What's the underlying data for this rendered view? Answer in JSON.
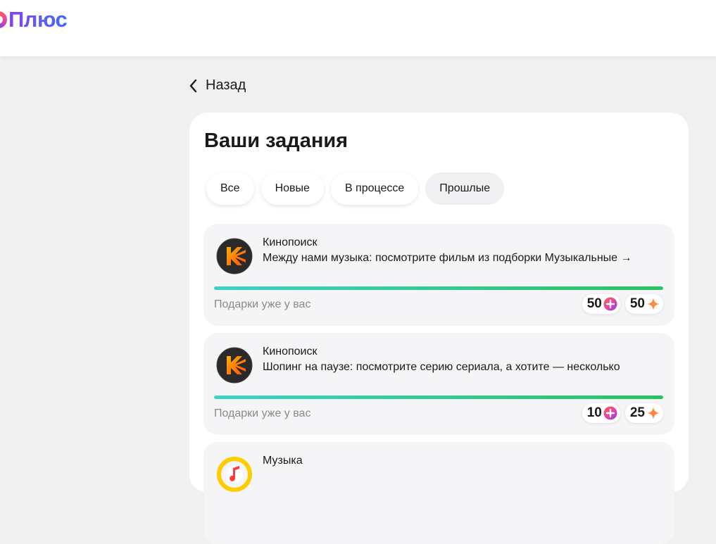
{
  "header": {
    "logo_text": "Плюс"
  },
  "back": {
    "label": "Назад"
  },
  "panel": {
    "title": "Ваши задания",
    "tabs": [
      {
        "label": "Все",
        "active": false
      },
      {
        "label": "Новые",
        "active": false
      },
      {
        "label": "В процессе",
        "active": false
      },
      {
        "label": "Прошлые",
        "active": true
      }
    ]
  },
  "tasks": [
    {
      "service": "Кинопоиск",
      "icon": "kinopoisk-logo-icon",
      "title": "Между нами музыка: посмотрите фильм из подборки Музыкальные →",
      "progress": 1.0,
      "status": "Подарки уже у вас",
      "rewards": [
        {
          "value": "50",
          "icon": "plus-points-icon"
        },
        {
          "value": "50",
          "icon": "sparkle-icon"
        }
      ]
    },
    {
      "service": "Кинопоиск",
      "icon": "kinopoisk-logo-icon",
      "title": "Шопинг на паузе: посмотрите серию сериала, а хотите — несколько",
      "progress": 1.0,
      "status": "Подарки уже у вас",
      "rewards": [
        {
          "value": "10",
          "icon": "plus-points-icon"
        },
        {
          "value": "25",
          "icon": "sparkle-icon"
        }
      ]
    },
    {
      "service": "Музыка",
      "icon": "yandex-music-logo-icon"
    }
  ],
  "colors": {
    "brand_gradient": [
      "#8341ef",
      "#3f68f9"
    ],
    "progress": [
      "#3dd2c8",
      "#22c55e"
    ],
    "sparkle": "#ff8a3d"
  }
}
